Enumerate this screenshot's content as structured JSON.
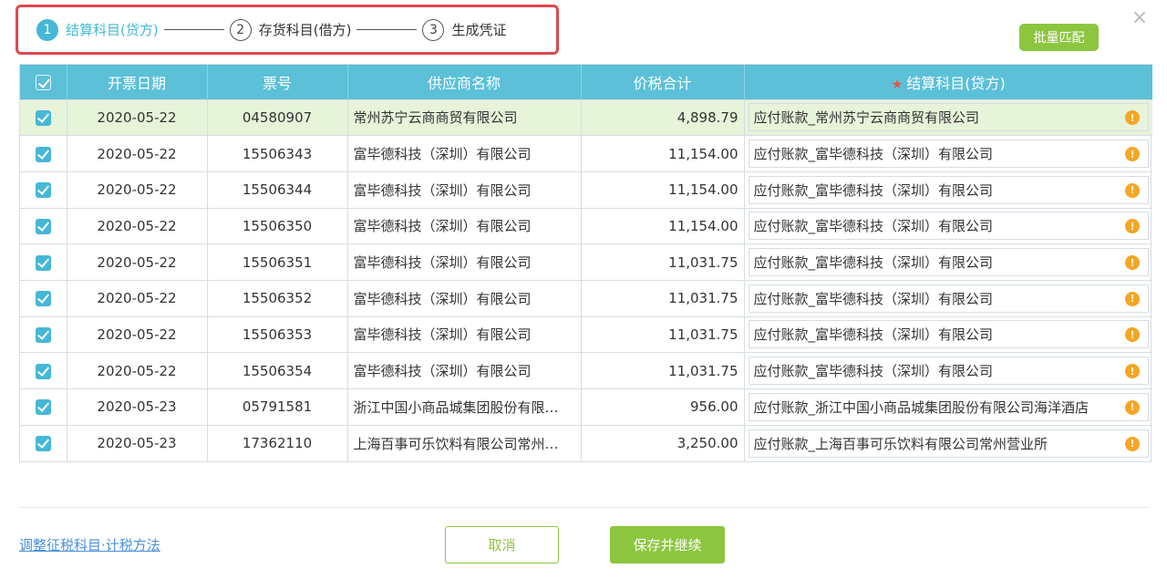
{
  "stepper": {
    "steps": [
      {
        "num": "1",
        "label": "结算科目(贷方)"
      },
      {
        "num": "2",
        "label": "存货科目(借方)"
      },
      {
        "num": "3",
        "label": "生成凭证"
      }
    ]
  },
  "close_label": "×",
  "batch_match_label": "批量匹配",
  "table": {
    "headers": {
      "date": "开票日期",
      "invoice_no": "票号",
      "supplier": "供应商名称",
      "amount": "价税合计",
      "account": "结算科目(贷方)"
    },
    "required_mark": "★",
    "warn_glyph": "!",
    "rows": [
      {
        "date": "2020-05-22",
        "no": "04580907",
        "supplier": "常州苏宁云商商贸有限公司",
        "amount": "4,898.79",
        "account": "应付账款_常州苏宁云商商贸有限公司"
      },
      {
        "date": "2020-05-22",
        "no": "15506343",
        "supplier": "富毕德科技（深圳）有限公司",
        "amount": "11,154.00",
        "account": "应付账款_富毕德科技（深圳）有限公司"
      },
      {
        "date": "2020-05-22",
        "no": "15506344",
        "supplier": "富毕德科技（深圳）有限公司",
        "amount": "11,154.00",
        "account": "应付账款_富毕德科技（深圳）有限公司"
      },
      {
        "date": "2020-05-22",
        "no": "15506350",
        "supplier": "富毕德科技（深圳）有限公司",
        "amount": "11,154.00",
        "account": "应付账款_富毕德科技（深圳）有限公司"
      },
      {
        "date": "2020-05-22",
        "no": "15506351",
        "supplier": "富毕德科技（深圳）有限公司",
        "amount": "11,031.75",
        "account": "应付账款_富毕德科技（深圳）有限公司"
      },
      {
        "date": "2020-05-22",
        "no": "15506352",
        "supplier": "富毕德科技（深圳）有限公司",
        "amount": "11,031.75",
        "account": "应付账款_富毕德科技（深圳）有限公司"
      },
      {
        "date": "2020-05-22",
        "no": "15506353",
        "supplier": "富毕德科技（深圳）有限公司",
        "amount": "11,031.75",
        "account": "应付账款_富毕德科技（深圳）有限公司"
      },
      {
        "date": "2020-05-22",
        "no": "15506354",
        "supplier": "富毕德科技（深圳）有限公司",
        "amount": "11,031.75",
        "account": "应付账款_富毕德科技（深圳）有限公司"
      },
      {
        "date": "2020-05-23",
        "no": "05791581",
        "supplier": "浙江中国小商品城集团股份有限…",
        "amount": "956.00",
        "account": "应付账款_浙江中国小商品城集团股份有限公司海洋酒店"
      },
      {
        "date": "2020-05-23",
        "no": "17362110",
        "supplier": "上海百事可乐饮料有限公司常州…",
        "amount": "3,250.00",
        "account": "应付账款_上海百事可乐饮料有限公司常州营业所"
      }
    ]
  },
  "footer": {
    "adjust_link": "调整征税科目·计税方法",
    "cancel_label": "取消",
    "save_label": "保存并继续"
  },
  "colors": {
    "accent": "#45b8d6",
    "header_bg": "#5bc0d8",
    "primary_green": "#8cc63f",
    "selected_row": "#e6f4da",
    "highlight_border": "#e0474f",
    "warning": "#f5a623"
  }
}
